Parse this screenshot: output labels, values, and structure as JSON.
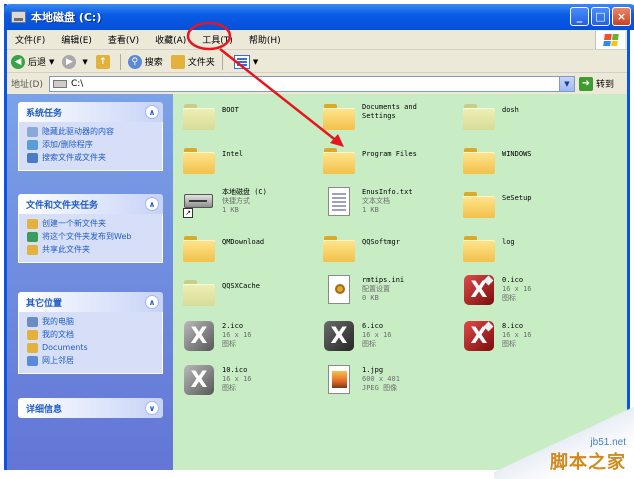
{
  "window": {
    "title": "本地磁盘 (C:)"
  },
  "title_buttons": [
    "_",
    "□",
    "×"
  ],
  "menu": [
    "文件(F)",
    "编辑(E)",
    "查看(V)",
    "收藏(A)",
    "工具(T)",
    "帮助(H)"
  ],
  "toolbar": {
    "back": "后退",
    "search": "搜索",
    "folders": "文件夹"
  },
  "address": {
    "label": "地址(D)",
    "value": "C:\\",
    "go": "转到"
  },
  "panels": [
    {
      "title": "系统任务",
      "links": [
        "隐藏此驱动器的内容",
        "添加/删除程序",
        "搜索文件或文件夹"
      ]
    },
    {
      "title": "文件和文件夹任务",
      "links": [
        "创建一个新文件夹",
        "将这个文件夹发布到Web",
        "共享此文件夹"
      ]
    },
    {
      "title": "其它位置",
      "links": [
        "我的电脑",
        "我的文档",
        "Documents",
        "网上邻居"
      ]
    },
    {
      "title": "详细信息",
      "links": []
    }
  ],
  "files": [
    {
      "name": "BOOT",
      "icon": "folder-faded"
    },
    {
      "name": "Documents and Settings",
      "icon": "folder"
    },
    {
      "name": "dosh",
      "icon": "folder-faded"
    },
    {
      "name": "Intel",
      "icon": "folder"
    },
    {
      "name": "Program Files",
      "icon": "folder"
    },
    {
      "name": "WINDOWS",
      "icon": "folder"
    },
    {
      "name": "本地磁盘 (C)",
      "sub1": "快捷方式",
      "sub2": "1 KB",
      "icon": "drive-shortcut"
    },
    {
      "name": "EnusInfo.txt",
      "sub1": "文本文档",
      "sub2": "1 KB",
      "icon": "text-doc"
    },
    {
      "name": "SeSetup",
      "icon": "folder"
    },
    {
      "name": "QMDownload",
      "icon": "folder"
    },
    {
      "name": "QQSoftmgr",
      "icon": "folder"
    },
    {
      "name": "log",
      "icon": "folder"
    },
    {
      "name": "QQSXCache",
      "icon": "folder-faded"
    },
    {
      "name": "rmtips.ini",
      "sub1": "配置设置",
      "sub2": "0 KB",
      "icon": "config-file"
    },
    {
      "name": "0.ico",
      "sub1": "16 x 16",
      "sub2": "图标",
      "icon": "x-icon-red"
    },
    {
      "name": "2.ico",
      "sub1": "16 x 16",
      "sub2": "图标",
      "icon": "x-icon-grey"
    },
    {
      "name": "6.ico",
      "sub1": "16 x 16",
      "sub2": "图标",
      "icon": "x-icon-dark"
    },
    {
      "name": "8.ico",
      "sub1": "16 x 16",
      "sub2": "图标",
      "icon": "x-icon-red"
    },
    {
      "name": "10.ico",
      "sub1": "16 x 16",
      "sub2": "图标",
      "icon": "x-icon-grey"
    },
    {
      "name": "1.jpg",
      "sub1": "600 x 401",
      "sub2": "JPEG 图像",
      "icon": "jpeg-image"
    }
  ],
  "annotation": {
    "target": "工具(T)",
    "color": "#e8141e"
  },
  "watermark": {
    "url": "jb51.net",
    "name": "脚本之家"
  }
}
